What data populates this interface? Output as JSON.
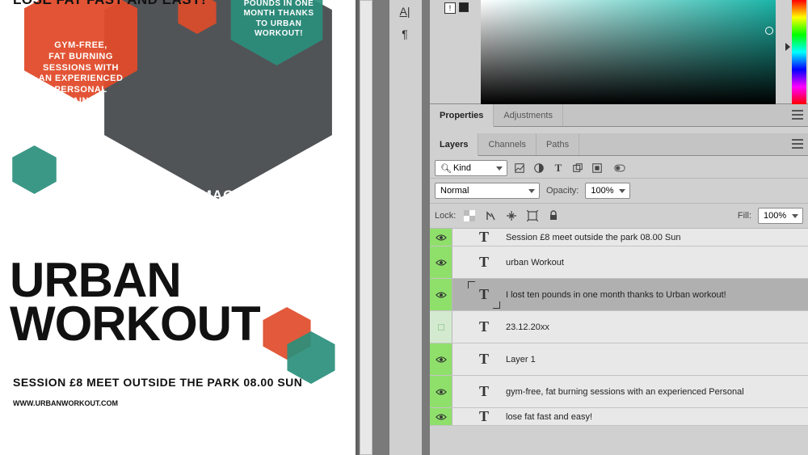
{
  "doc": {
    "headline": "LOSE FAT FAST AND EASY!",
    "red_badge": "GYM-FREE,\nFAT BURNING\nSESSIONS WITH\nAN EXPERIENCED\nPERSONAL\nTRAINER",
    "teal_badge": "I LOST TEN\nPOUNDS IN ONE\nMONTH THANKS\nTO URBAN\nWORKOUT!",
    "image_here": "IMAGE HERE",
    "title1": "URBAN",
    "title2": "WORKOUT",
    "session": "SESSION £8   MEET OUTSIDE THE PARK 08.00 SUN",
    "url": "WWW.URBANWORKOUT.COM"
  },
  "panels": {
    "props": {
      "tab1": "Properties",
      "tab2": "Adjustments"
    },
    "layers": {
      "tab1": "Layers",
      "tab2": "Channels",
      "tab3": "Paths",
      "filter_kind": "Kind",
      "blend": "Normal",
      "opacity_label": "Opacity:",
      "opacity_val": "100%",
      "lock_label": "Lock:",
      "fill_label": "Fill:",
      "fill_val": "100%",
      "rows": [
        {
          "vis": true,
          "type": "T",
          "name": "Session £8   meet outside the park 08.00 Sun",
          "cut": true
        },
        {
          "vis": true,
          "type": "T",
          "name": "urban Workout"
        },
        {
          "vis": true,
          "type": "T",
          "name": "I lost ten pounds in one month thanks to Urban workout!",
          "selected": true
        },
        {
          "vis": false,
          "type": "T",
          "name": "23.12.20xx"
        },
        {
          "vis": true,
          "type": "T",
          "name": "Layer 1"
        },
        {
          "vis": true,
          "type": "T",
          "name": "gym-free,  fat burning sessions with  an experienced  Personal"
        },
        {
          "vis": true,
          "type": "T",
          "name": "lose fat fast and easy!",
          "cut": true
        }
      ]
    }
  },
  "search_icon": "⚲"
}
